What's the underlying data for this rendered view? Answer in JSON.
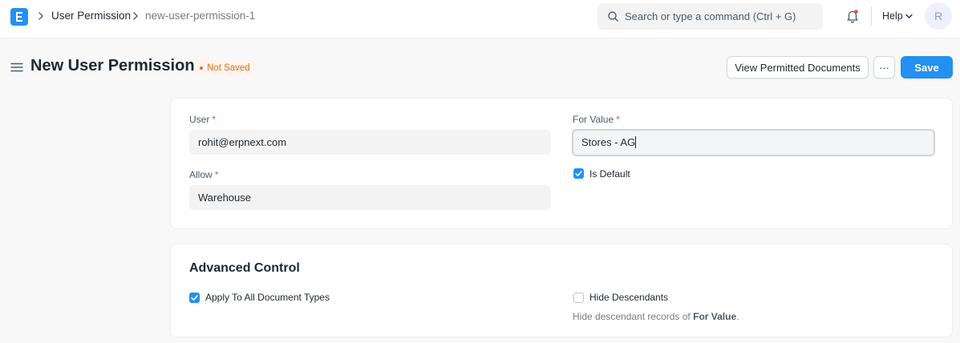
{
  "navbar": {
    "breadcrumbs": [
      "User Permission",
      "new-user-permission-1"
    ],
    "search_placeholder": "Search or type a command (Ctrl + G)",
    "help_label": "Help",
    "avatar_initial": "R"
  },
  "page": {
    "title": "New User Permission",
    "status": "Not Saved",
    "view_button": "View Permitted Documents",
    "more_button": "···",
    "save_button": "Save"
  },
  "form": {
    "user_label": "User",
    "user_value": "rohit@erpnext.com",
    "allow_label": "Allow",
    "allow_value": "Warehouse",
    "for_value_label": "For Value",
    "for_value_value": "Stores - AG",
    "is_default_label": "Is Default",
    "is_default_checked": true,
    "required_mark": "*"
  },
  "advanced": {
    "title": "Advanced Control",
    "apply_all_label": "Apply To All Document Types",
    "apply_all_checked": true,
    "hide_desc_label": "Hide Descendants",
    "hide_desc_checked": false,
    "hide_desc_help_prefix": "Hide descendant records of",
    "hide_desc_help_field": "For Value",
    "hide_desc_help_suffix": "."
  },
  "colors": {
    "primary": "#2490ef",
    "status_orange": "#e86c13",
    "required_red": "#e24c4c"
  }
}
